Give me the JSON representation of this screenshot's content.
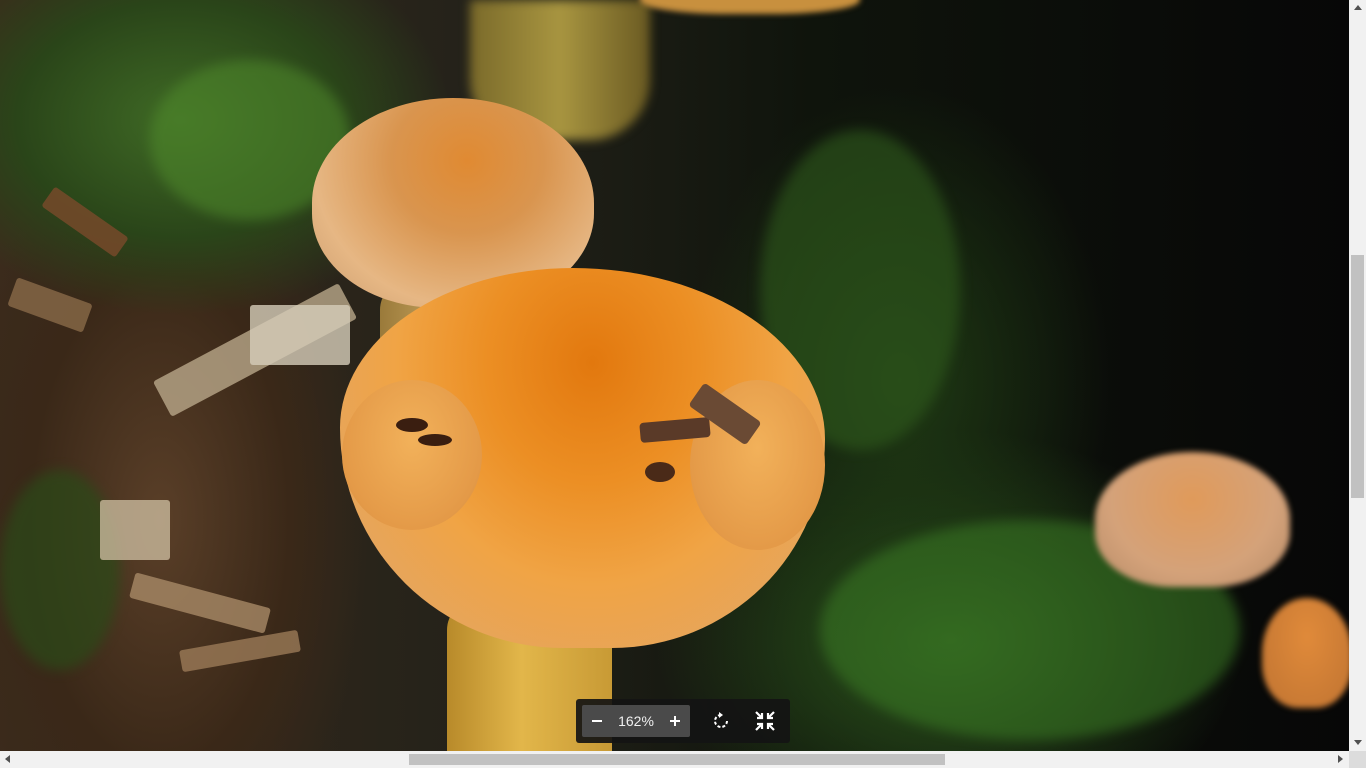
{
  "viewer": {
    "image_subject": "orange-mushrooms-on-mossy-log",
    "zoom_label": "162%",
    "zoom_out_icon": "minus-icon",
    "zoom_in_icon": "plus-icon",
    "rotate_icon": "rotate-icon",
    "fit_icon": "compress-icon"
  },
  "scrollbars": {
    "vertical_position": 0.34,
    "horizontal_position": 0.42
  },
  "colors": {
    "toolbar_bg": "#141414",
    "zoom_group_bg": "#4a4a4a",
    "cap_orange": "#ec8f24"
  }
}
